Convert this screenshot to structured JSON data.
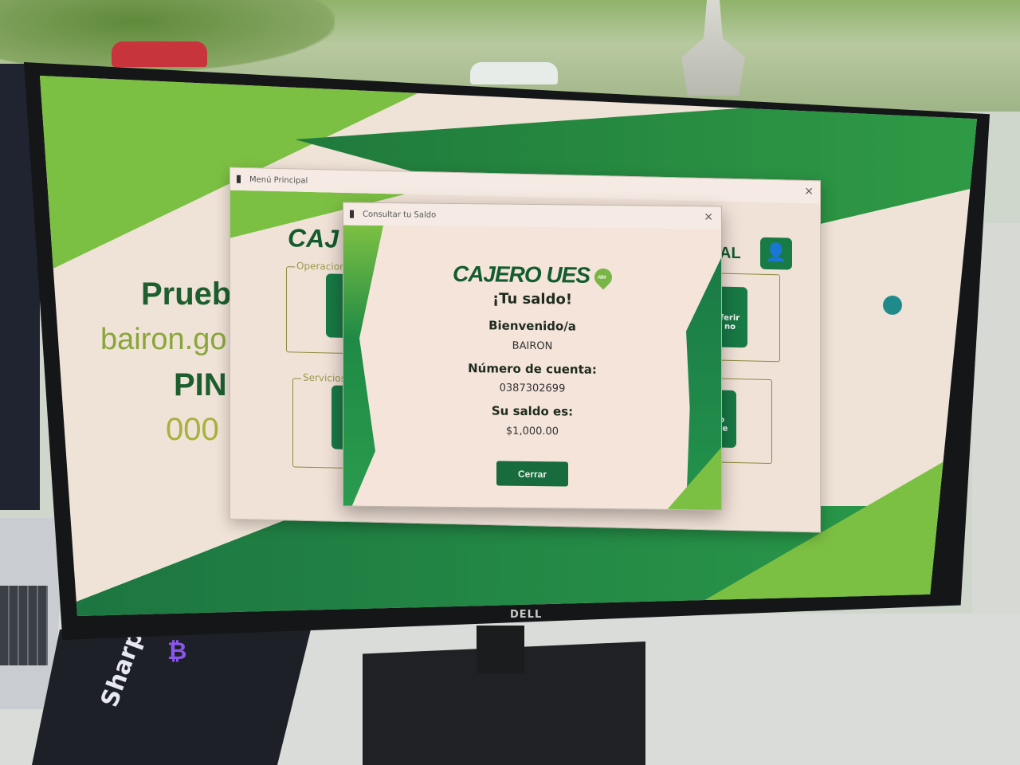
{
  "desktop": {
    "lines": [
      "Prueb",
      "bairon.go",
      "PIN:",
      "000"
    ],
    "colors": {
      "dark_green": "#135c2e",
      "light_green": "#7ab547",
      "accent": "#187a45",
      "background": "#efe2d6"
    }
  },
  "menu_window": {
    "title": "Menú Principal",
    "brand_partial": "CAJ",
    "brand_suffix_partial": "AL",
    "groups": [
      "Operacion",
      "Servicios"
    ],
    "tiles_partial": [
      "ferir\nno",
      "lo\nnte"
    ],
    "icons": [
      "user-icon",
      "transfer-icon",
      "clock-icon"
    ]
  },
  "dialog": {
    "title": "Consultar tu Saldo",
    "brand": "CAJERO UES",
    "badge": "ATM",
    "heading": "¡Tu saldo!",
    "welcome_label": "Bienvenido/a",
    "user_name": "BAIRON",
    "account_label": "Número de cuenta:",
    "account_number": "0387302699",
    "balance_label": "Su saldo es:",
    "balance": "$1,000.00",
    "close_button": "Cerrar"
  },
  "monitor": {
    "brand": "DELL"
  },
  "book": {
    "title": "SharpBank"
  }
}
